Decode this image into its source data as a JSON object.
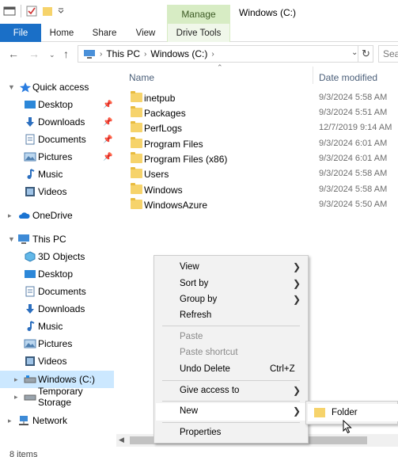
{
  "titlebar": {
    "manage_label": "Manage",
    "window_title": "Windows (C:)"
  },
  "ribbon": {
    "tabs": [
      "File",
      "Home",
      "Share",
      "View",
      "Drive Tools"
    ]
  },
  "address": {
    "crumbs": [
      "This PC",
      "Windows (C:)"
    ],
    "search_placeholder": "Sea"
  },
  "nav": {
    "quick_access": "Quick access",
    "quick_items": [
      "Desktop",
      "Downloads",
      "Documents",
      "Pictures",
      "Music",
      "Videos"
    ],
    "onedrive": "OneDrive",
    "this_pc": "This PC",
    "pc_items": [
      "3D Objects",
      "Desktop",
      "Documents",
      "Downloads",
      "Music",
      "Pictures",
      "Videos",
      "Windows (C:)",
      "Temporary Storage"
    ],
    "network": "Network"
  },
  "columns": {
    "name": "Name",
    "date": "Date modified"
  },
  "files": [
    {
      "name": "inetpub",
      "date": "9/3/2024 5:58 AM"
    },
    {
      "name": "Packages",
      "date": "9/3/2024 5:51 AM"
    },
    {
      "name": "PerfLogs",
      "date": "12/7/2019 9:14 AM"
    },
    {
      "name": "Program Files",
      "date": "9/3/2024 6:01 AM"
    },
    {
      "name": "Program Files (x86)",
      "date": "9/3/2024 6:01 AM"
    },
    {
      "name": "Users",
      "date": "9/3/2024 5:58 AM"
    },
    {
      "name": "Windows",
      "date": "9/3/2024 5:58 AM"
    },
    {
      "name": "WindowsAzure",
      "date": "9/3/2024 5:50 AM"
    }
  ],
  "status": "8 items",
  "context_menu": {
    "view": "View",
    "sort_by": "Sort by",
    "group_by": "Group by",
    "refresh": "Refresh",
    "paste": "Paste",
    "paste_shortcut": "Paste shortcut",
    "undo_delete": "Undo Delete",
    "undo_shortcut": "Ctrl+Z",
    "give_access": "Give access to",
    "new": "New",
    "properties": "Properties"
  },
  "submenu": {
    "folder": "Folder"
  },
  "colors": {
    "file_tab": "#1a6fc7",
    "manage_tab": "#d7ecc4",
    "selected": "#cce8ff",
    "folder": "#f6d36b"
  }
}
